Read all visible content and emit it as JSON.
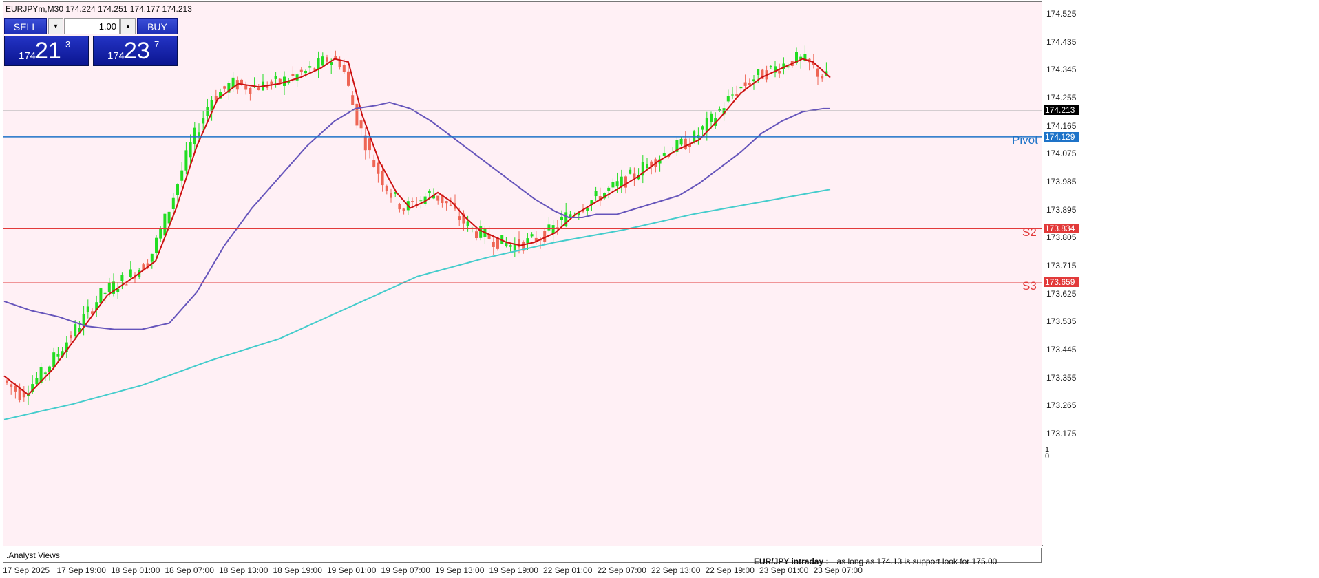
{
  "symbol_info": "EURJPYm,M30  174.224 174.251 174.177 174.213",
  "trade_panel": {
    "sell_label": "SELL",
    "buy_label": "BUY",
    "lot": "1.00",
    "sell_price": {
      "prefix": "174",
      "big": "21",
      "sup": "3"
    },
    "buy_price": {
      "prefix": "174",
      "big": "23",
      "sup": "7"
    }
  },
  "price_axis": [
    "174.525",
    "174.435",
    "174.345",
    "174.255",
    "174.165",
    "174.075",
    "173.985",
    "173.895",
    "173.805",
    "173.715",
    "173.625",
    "173.535",
    "173.445",
    "173.355",
    "173.265",
    "173.175"
  ],
  "levels": {
    "current": {
      "label": "174.213",
      "color": "#000000"
    },
    "pivot": {
      "name": "Pivot",
      "label": "174.129",
      "color": "#1e73c8"
    },
    "s2": {
      "name": "S2",
      "label": "173.834",
      "color": "#e23a3a"
    },
    "s3": {
      "name": "S3",
      "label": "173.659",
      "color": "#e23a3a"
    }
  },
  "time_axis": [
    "17 Sep 2025",
    "17 Sep 19:00",
    "18 Sep 01:00",
    "18 Sep 07:00",
    "18 Sep 13:00",
    "18 Sep 19:00",
    "19 Sep 01:00",
    "19 Sep 07:00",
    "19 Sep 13:00",
    "19 Sep 19:00",
    "22 Sep 01:00",
    "22 Sep 07:00",
    "22 Sep 13:00",
    "22 Sep 19:00",
    "23 Sep 01:00",
    "23 Sep 07:00"
  ],
  "sub_panel": {
    "name": ".Analyst Views",
    "scale_top": "1",
    "scale_bottom": "0",
    "analyst_title": "EUR/JPY intraday :",
    "analyst_body": "as long as 174.13 is support look for 175.00"
  },
  "colors": {
    "bull": "#22dd22",
    "bear": "#ee6655",
    "ma_fast": "#cc1111",
    "ma_mid": "#6655bb",
    "ma_slow": "#44cccc"
  },
  "chart_data": {
    "type": "candlestick",
    "price_range": [
      173.13,
      174.56
    ],
    "moving_averages": {
      "fast": [
        [
          0,
          173.36
        ],
        [
          35,
          173.3
        ],
        [
          70,
          173.38
        ],
        [
          110,
          173.5
        ],
        [
          150,
          173.62
        ],
        [
          190,
          173.68
        ],
        [
          220,
          173.73
        ],
        [
          250,
          173.9
        ],
        [
          280,
          174.1
        ],
        [
          310,
          174.25
        ],
        [
          340,
          174.3
        ],
        [
          370,
          174.29
        ],
        [
          400,
          174.3
        ],
        [
          430,
          174.32
        ],
        [
          460,
          174.35
        ],
        [
          480,
          174.38
        ],
        [
          500,
          174.37
        ],
        [
          520,
          174.2
        ],
        [
          545,
          174.05
        ],
        [
          570,
          173.95
        ],
        [
          590,
          173.9
        ],
        [
          610,
          173.92
        ],
        [
          630,
          173.95
        ],
        [
          650,
          173.92
        ],
        [
          670,
          173.87
        ],
        [
          690,
          173.83
        ],
        [
          710,
          173.81
        ],
        [
          730,
          173.79
        ],
        [
          750,
          173.78
        ],
        [
          770,
          173.79
        ],
        [
          800,
          173.82
        ],
        [
          830,
          173.88
        ],
        [
          860,
          173.92
        ],
        [
          890,
          173.96
        ],
        [
          920,
          174.0
        ],
        [
          950,
          174.05
        ],
        [
          980,
          174.09
        ],
        [
          1010,
          174.12
        ],
        [
          1040,
          174.19
        ],
        [
          1070,
          174.27
        ],
        [
          1100,
          174.32
        ],
        [
          1130,
          174.35
        ],
        [
          1160,
          174.38
        ],
        [
          1175,
          174.37
        ],
        [
          1200,
          174.32
        ]
      ],
      "mid": [
        [
          0,
          173.6
        ],
        [
          40,
          173.57
        ],
        [
          80,
          173.55
        ],
        [
          120,
          173.52
        ],
        [
          160,
          173.51
        ],
        [
          200,
          173.51
        ],
        [
          240,
          173.53
        ],
        [
          280,
          173.63
        ],
        [
          320,
          173.78
        ],
        [
          360,
          173.9
        ],
        [
          400,
          174.0
        ],
        [
          440,
          174.1
        ],
        [
          480,
          174.18
        ],
        [
          510,
          174.22
        ],
        [
          540,
          174.23
        ],
        [
          560,
          174.24
        ],
        [
          590,
          174.22
        ],
        [
          620,
          174.18
        ],
        [
          650,
          174.13
        ],
        [
          680,
          174.08
        ],
        [
          710,
          174.03
        ],
        [
          740,
          173.98
        ],
        [
          770,
          173.93
        ],
        [
          800,
          173.89
        ],
        [
          820,
          173.87
        ],
        [
          840,
          173.87
        ],
        [
          860,
          173.88
        ],
        [
          890,
          173.88
        ],
        [
          920,
          173.9
        ],
        [
          950,
          173.92
        ],
        [
          980,
          173.94
        ],
        [
          1010,
          173.98
        ],
        [
          1040,
          174.03
        ],
        [
          1070,
          174.08
        ],
        [
          1100,
          174.14
        ],
        [
          1130,
          174.18
        ],
        [
          1160,
          174.21
        ],
        [
          1190,
          174.22
        ],
        [
          1200,
          174.22
        ]
      ],
      "slow": [
        [
          0,
          173.22
        ],
        [
          100,
          173.27
        ],
        [
          200,
          173.33
        ],
        [
          300,
          173.41
        ],
        [
          400,
          173.48
        ],
        [
          500,
          173.58
        ],
        [
          600,
          173.68
        ],
        [
          700,
          173.74
        ],
        [
          800,
          173.79
        ],
        [
          900,
          173.83
        ],
        [
          1000,
          173.88
        ],
        [
          1100,
          173.92
        ],
        [
          1200,
          173.96
        ]
      ]
    },
    "levels": [
      {
        "name": "Pivot",
        "value": 174.129
      },
      {
        "name": "S2",
        "value": 173.834
      },
      {
        "name": "S3",
        "value": 173.659
      },
      {
        "name": "current",
        "value": 174.213
      }
    ]
  }
}
